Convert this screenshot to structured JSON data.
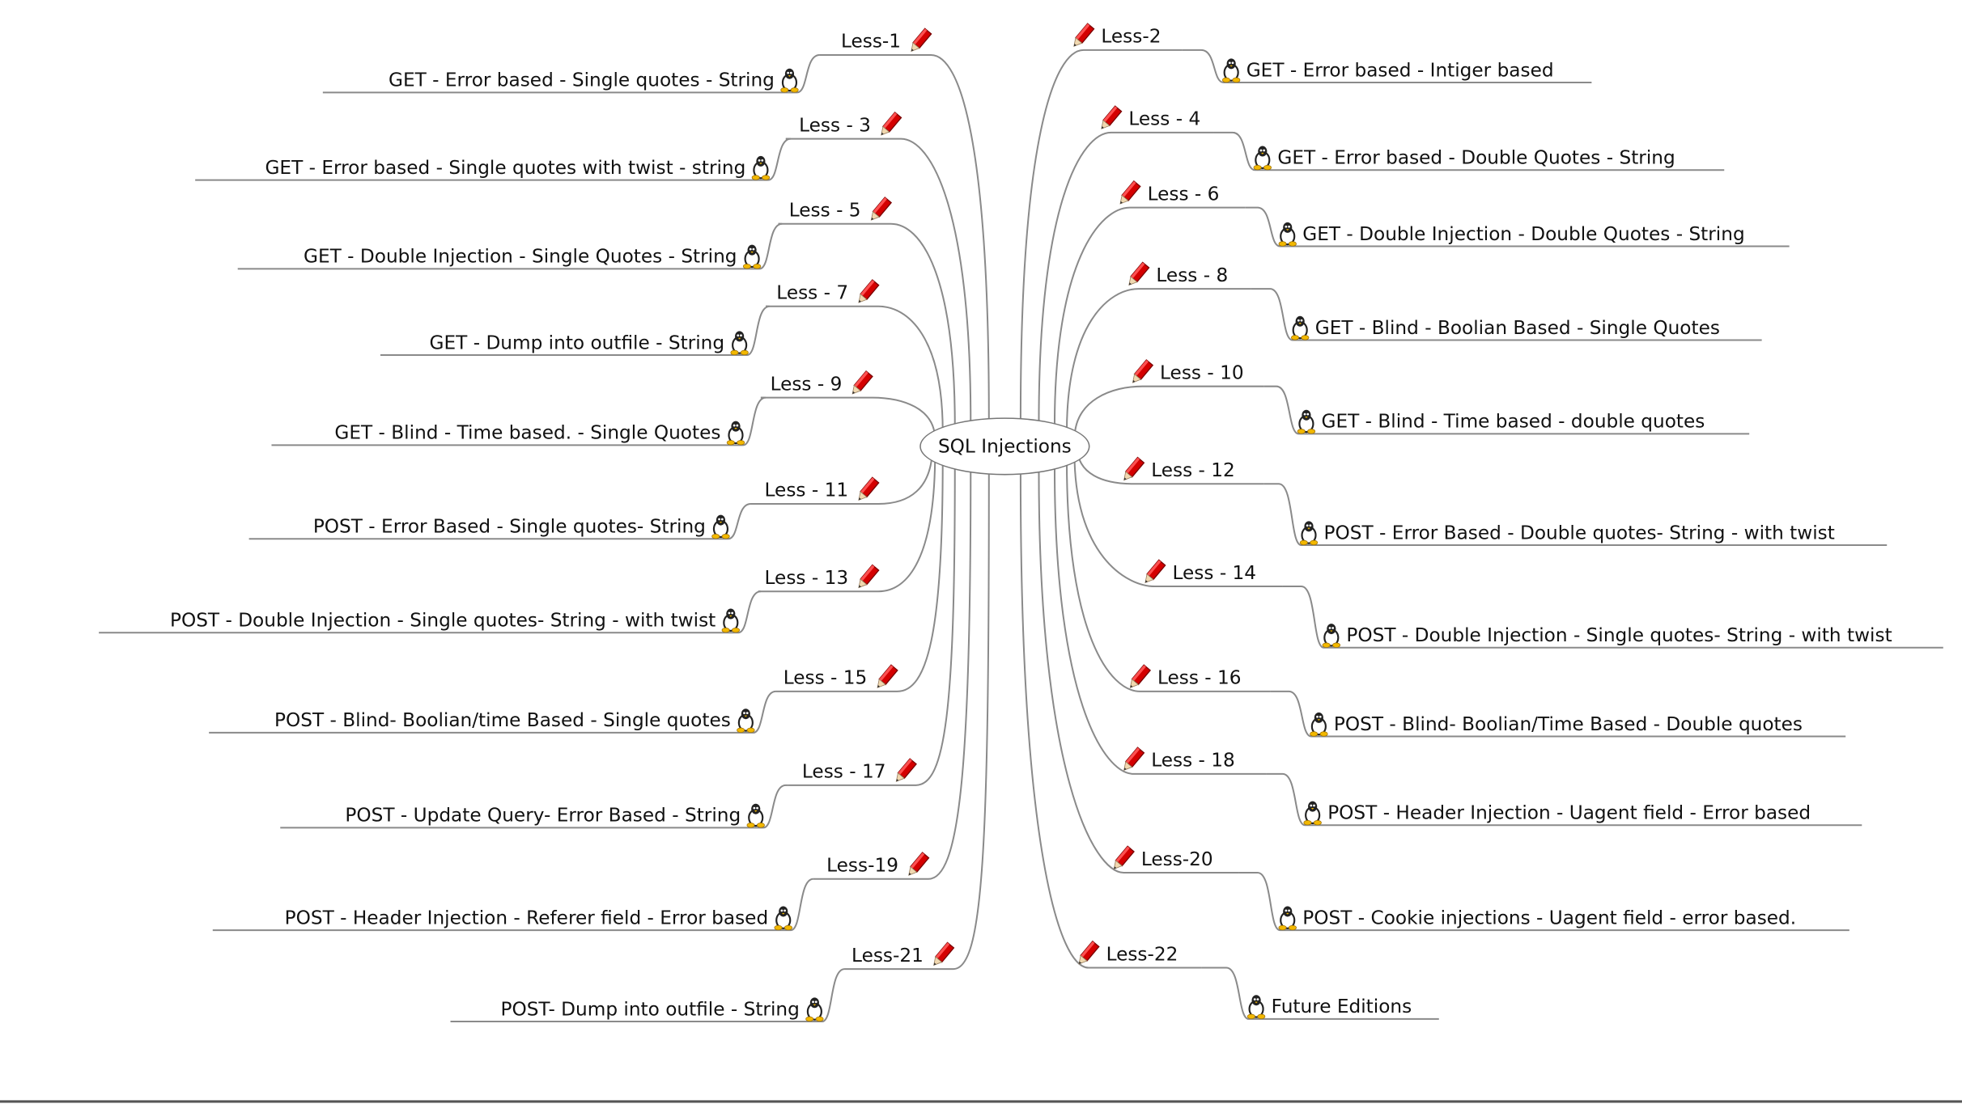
{
  "central_topic": "SQL Injections",
  "colors": {
    "pencil": "#d40000",
    "connector": "#8a8a8a",
    "penguin_feet": "#f2b800"
  },
  "icons": {
    "lesson": "pencil-icon",
    "challenge": "penguin-icon"
  },
  "left_branches": [
    {
      "lesson": "Less-1",
      "topic": "GET - Error based - Single quotes - String"
    },
    {
      "lesson": "Less - 3",
      "topic": "GET - Error based - Single quotes with twist - string"
    },
    {
      "lesson": "Less - 5",
      "topic": "GET - Double Injection - Single Quotes - String"
    },
    {
      "lesson": "Less - 7",
      "topic": "GET - Dump into outfile - String"
    },
    {
      "lesson": "Less - 9",
      "topic": "GET - Blind - Time based. -  Single Quotes"
    },
    {
      "lesson": "Less - 11",
      "topic": "POST - Error Based - Single quotes- String"
    },
    {
      "lesson": "Less - 13",
      "topic": "POST - Double Injection - Single quotes- String - with twist"
    },
    {
      "lesson": "Less - 15",
      "topic": "POST - Blind- Boolian/time Based - Single quotes"
    },
    {
      "lesson": "Less - 17",
      "topic": "POST - Update Query- Error Based - String"
    },
    {
      "lesson": "Less-19",
      "topic": "POST - Header Injection - Referer field - Error based"
    },
    {
      "lesson": "Less-21",
      "topic": "POST- Dump into outfile - String"
    }
  ],
  "right_branches": [
    {
      "lesson": "Less-2",
      "topic": "GET - Error based - Intiger based"
    },
    {
      "lesson": "Less - 4",
      "topic": "GET - Error based - Double Quotes - String"
    },
    {
      "lesson": "Less - 6",
      "topic": "GET - Double Injection - Double Quotes - String"
    },
    {
      "lesson": "Less - 8",
      "topic": "GET - Blind - Boolian Based - Single Quotes"
    },
    {
      "lesson": "Less - 10",
      "topic": "GET - Blind - Time based - double quotes"
    },
    {
      "lesson": "Less - 12",
      "topic": "POST - Error Based - Double quotes- String - with twist"
    },
    {
      "lesson": "Less - 14",
      "topic": "POST - Double Injection - Single quotes- String - with twist"
    },
    {
      "lesson": "Less - 16",
      "topic": "POST - Blind- Boolian/Time Based - Double quotes"
    },
    {
      "lesson": "Less - 18",
      "topic": "POST - Header Injection - Uagent field - Error based"
    },
    {
      "lesson": "Less-20",
      "topic": "POST - Cookie injections - Uagent field - error based."
    },
    {
      "lesson": "Less-22",
      "topic": "Future Editions"
    }
  ]
}
